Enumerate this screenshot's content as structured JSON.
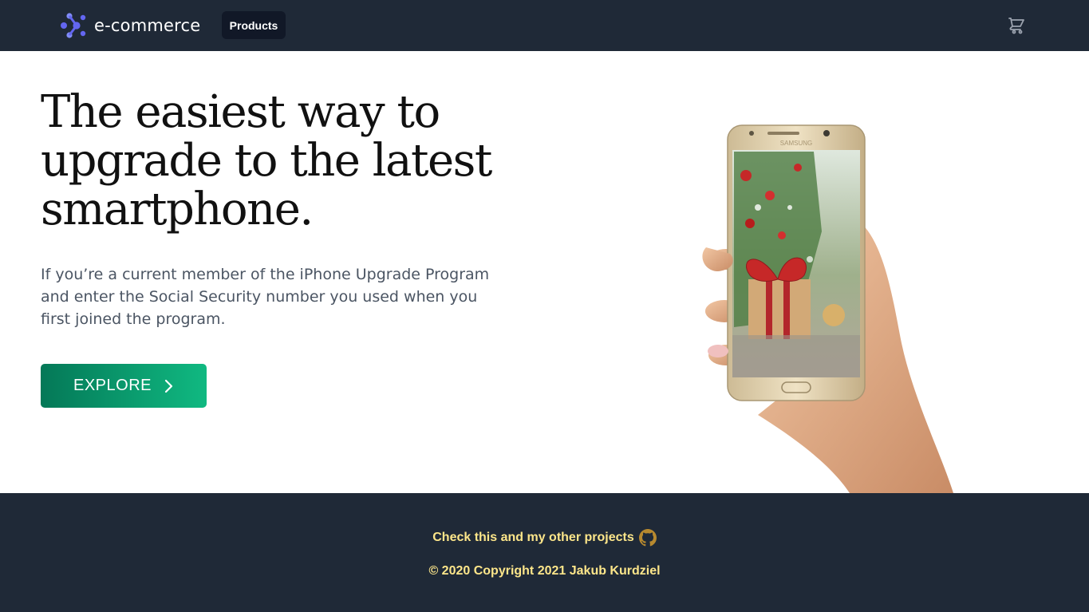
{
  "header": {
    "logo_text": "e-commerce",
    "products_label": "Products",
    "cart_icon": "cart-icon"
  },
  "hero": {
    "title": "The easiest way to upgrade to the latest smartphone.",
    "description": "If you’re a current member of the iPhone Upgrade Program and enter the Social Security number you used when you first joined the program.",
    "explore_label": "EXPLORE",
    "explore_icon": "chevron-right-icon",
    "image_phone_brand": "SAMSUNG"
  },
  "footer": {
    "projects_link": "Check this and my other projects",
    "github_icon": "github-icon",
    "copyright": "© 2020 Copyright 2021 Jakub Kurdziel"
  },
  "colors": {
    "nav_bg": "#1f2937",
    "accent_green": "#10b981",
    "footer_text": "#fde68a",
    "logo_icon": "#6366f1"
  }
}
